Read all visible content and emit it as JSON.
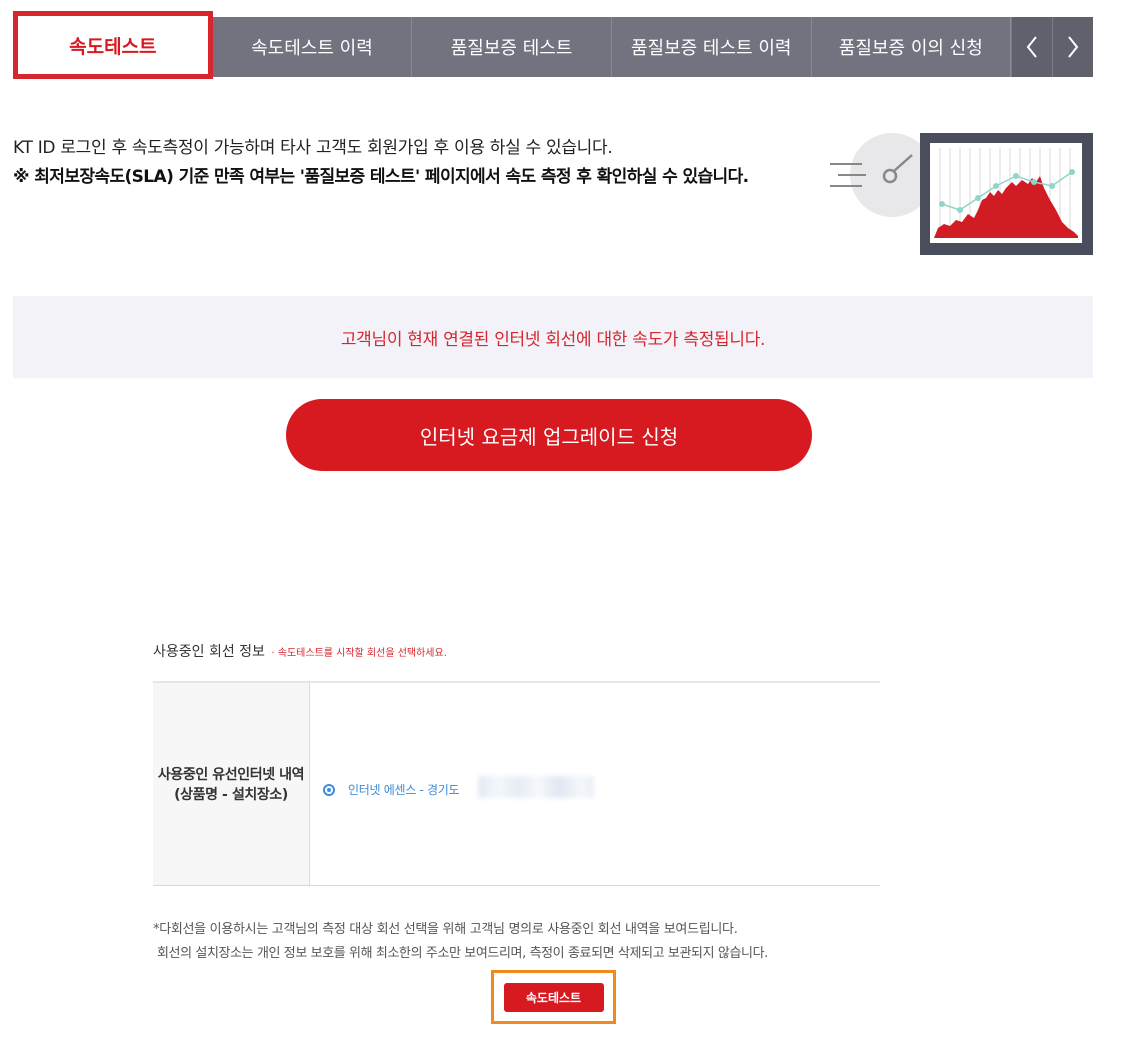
{
  "tabs": [
    {
      "label": "속도테스트",
      "active": true
    },
    {
      "label": "속도테스트 이력",
      "active": false
    },
    {
      "label": "품질보증 테스트",
      "active": false
    },
    {
      "label": "품질보증 테스트 이력",
      "active": false
    },
    {
      "label": "품질보증 이의 신청",
      "active": false
    }
  ],
  "tab_nav": {
    "prev_icon": "chevron-left-icon",
    "next_icon": "chevron-right-icon"
  },
  "intro": {
    "line1": "KT ID 로그인 후 속도측정이 가능하며 타사 고객도 회원가입 후 이용 하실 수 있습니다.",
    "line2": "※ 최저보장속도(SLA) 기준 만족 여부는 '품질보증 테스트' 페이지에서 속도 측정 후 확인하실 수 있습니다."
  },
  "notice": {
    "text": "고객님이 현재 연결된 인터넷 회선에 대한 속도가 측정됩니다."
  },
  "upgrade_button": {
    "label": "인터넷 요금제 업그레이드 신청"
  },
  "line_info": {
    "title": "사용중인 회선 정보",
    "hint": "· 속도테스트를 시작할 회선을 선택하세요.",
    "row_header_line1": "사용중인 유선인터넷 내역",
    "row_header_line2": "(상품명 - 설치장소)",
    "option_label": "인터넷 에센스 - 경기도",
    "option_selected": true
  },
  "notes": {
    "line1": "*다회선을 이용하시는 고객님의 측정 대상 회선 선택을 위해 고객님 명의로 사용중인 회선 내역을 보여드립니다.",
    "line2": "회선의 설치장소는 개인 정보 보호를 위해 최소한의 주소만 보여드리며, 측정이 종료되면 삭제되고 보관되지 않습니다."
  },
  "speed_test_button": {
    "label": "속도테스트"
  },
  "colors": {
    "brand_red": "#d71920",
    "tab_gray": "#737380",
    "notice_bg": "#f2f2f8",
    "highlight_orange": "#f08a1c",
    "link_blue": "#3a8bd8"
  }
}
